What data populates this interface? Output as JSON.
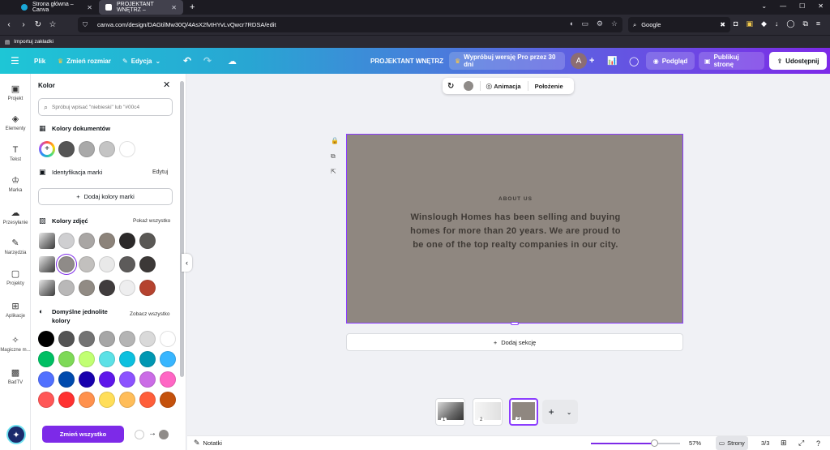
{
  "browser": {
    "tabs": [
      {
        "label": "Strona główna – Canva",
        "active": false
      },
      {
        "label": "PROJEKTANT WNĘTRZ –",
        "active": true
      }
    ],
    "url": "canva.com/design/DAGtilMw30Q/4AsX2fvtHYvLvQwcr7RDSA/edit",
    "search_engine": "Google",
    "bookmarks_label": "Importuj zakładki"
  },
  "topbar": {
    "menu_icon": "hamburger-icon",
    "file": "Plik",
    "resize": "Zmień rozmiar",
    "edit": "Edycja",
    "project_title": "PROJEKTANT WNĘTRZ",
    "try_pro": "Wypróbuj wersję Pro przez 30 dni",
    "avatar": "A",
    "preview": "Podgląd",
    "publish": "Publikuj stronę",
    "share": "Udostępnij"
  },
  "rail": [
    {
      "label": "Projekt",
      "icon": "layout-icon"
    },
    {
      "label": "Elementy",
      "icon": "shapes-icon"
    },
    {
      "label": "Tekst",
      "icon": "text-icon"
    },
    {
      "label": "Marka",
      "icon": "brand-icon"
    },
    {
      "label": "Przesyłanie",
      "icon": "upload-icon"
    },
    {
      "label": "Narzędzia",
      "icon": "pen-icon"
    },
    {
      "label": "Projekty",
      "icon": "folder-icon"
    },
    {
      "label": "Aplikacje",
      "icon": "apps-icon"
    },
    {
      "label": "Magiczne m...",
      "icon": "magic-icon"
    },
    {
      "label": "BadTV",
      "icon": "badtv-icon"
    }
  ],
  "panel": {
    "title": "Kolor",
    "search_placeholder": "Spróbuj wpisać \"niebieski\" lub \"#00c4",
    "doc_colors_title": "Kolory dokumentów",
    "doc_colors": [
      "#555555",
      "#a9a9a9",
      "#c4c4c4",
      "#ffffff"
    ],
    "brand_title": "Identyfikacja marki",
    "brand_edit": "Edytuj",
    "add_brand_colors": "Dodaj kolory marki",
    "photo_colors_title": "Kolory zdjęć",
    "photo_colors_more": "Pokaż wszystko",
    "photo_rows": [
      [
        "#cfcfd1",
        "#a9a6a4",
        "#8c837a",
        "#2c2a2a",
        "#5a5855"
      ],
      [
        "#8f8b88",
        "#c2c0be",
        "#e9e9e9",
        "#5d5b5a",
        "#3c3837"
      ],
      [
        "#b9b8b8",
        "#918b84",
        "#403c3d",
        "#eeeeef",
        "#b5432f"
      ]
    ],
    "default_colors_title": "Domyślne jednolite kolory",
    "default_colors_more": "Zobacz wszystko",
    "default_colors": [
      [
        "#000000",
        "#545454",
        "#737373",
        "#a6a6a6",
        "#b4b4b4",
        "#d9d9d9",
        "#ffffff"
      ],
      [
        "#00bf63",
        "#7ed957",
        "#c1ff72",
        "#5ce1e6",
        "#0cc0df",
        "#0097b2",
        "#38b6ff"
      ],
      [
        "#5170ff",
        "#004aad",
        "#1800ad",
        "#5e17eb",
        "#8c52ff",
        "#cb6ce6",
        "#ff66c4"
      ],
      [
        "#ff5757",
        "#ff3131",
        "#ff914d",
        "#ffde59",
        "#ffbd59",
        "#ff5e3a",
        "#c4510c"
      ]
    ],
    "change_all": "Zmień wszystko"
  },
  "floating_toolbar": {
    "animation": "Animacja",
    "position": "Położenie"
  },
  "design": {
    "background": "#8f8780",
    "heading": "ABOUT US",
    "body": "Winslough Homes has been selling and buying homes for more than 20 years. We are proud to be one of the top realty companies in our city."
  },
  "add_section": "Dodaj sekcję",
  "pages": [
    {
      "num": "1"
    },
    {
      "num": "2"
    },
    {
      "num": "3"
    }
  ],
  "bottom": {
    "notes": "Notatki",
    "zoom": "57%",
    "zoom_level": 0.57,
    "pages_label": "Strony",
    "page_count": "3/3"
  }
}
